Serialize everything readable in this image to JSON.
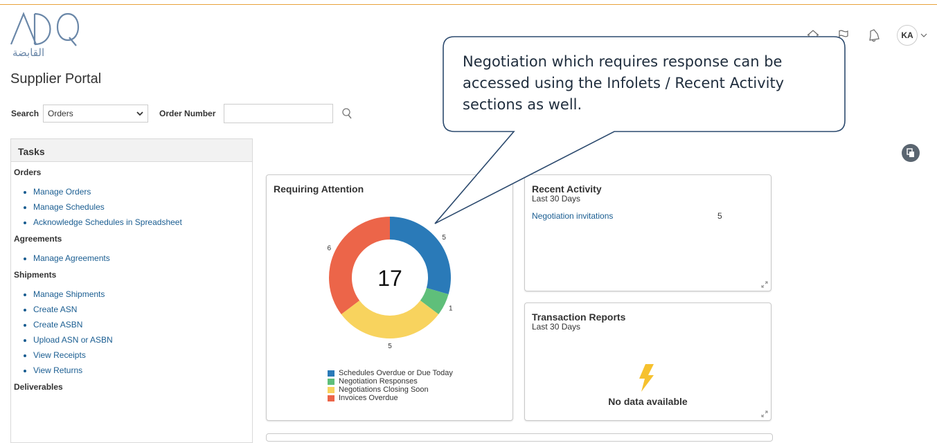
{
  "logo": {
    "latin": "ADQ",
    "arabic": "القابضة"
  },
  "portal_title": "Supplier Portal",
  "header": {
    "avatar_initials": "KA"
  },
  "search": {
    "label": "Search",
    "selected": "Orders",
    "order_number_label": "Order Number",
    "order_number_value": ""
  },
  "tasks": {
    "title": "Tasks",
    "sections": [
      {
        "title": "Orders",
        "items": [
          "Manage Orders",
          "Manage Schedules",
          "Acknowledge Schedules in Spreadsheet"
        ]
      },
      {
        "title": "Agreements",
        "items": [
          "Manage Agreements"
        ]
      },
      {
        "title": "Shipments",
        "items": [
          "Manage Shipments",
          "Create ASN",
          "Create ASBN",
          "Upload ASN or ASBN",
          "View Receipts",
          "View Returns"
        ]
      },
      {
        "title": "Deliverables",
        "items": []
      }
    ]
  },
  "requiring_attention": {
    "title": "Requiring Attention",
    "total": "17"
  },
  "chart_data": {
    "type": "pie",
    "donut": true,
    "title": "Requiring Attention",
    "center_label": "17",
    "categories": [
      "Schedules Overdue or Due Today",
      "Negotiation Responses",
      "Negotiations Closing Soon",
      "Invoices Overdue"
    ],
    "values": [
      5,
      1,
      5,
      6
    ],
    "colors": [
      "#2a7ab8",
      "#5fbf7a",
      "#f8d35e",
      "#ec6549"
    ],
    "legend_placement": "bottom"
  },
  "recent_activity": {
    "title": "Recent Activity",
    "subtitle": "Last 30 Days",
    "items": [
      {
        "label": "Negotiation invitations",
        "count": "5"
      }
    ]
  },
  "transaction_reports": {
    "title": "Transaction Reports",
    "subtitle": "Last 30 Days",
    "empty_text": "No data available"
  },
  "callout": {
    "line1": "Negotiation which requires response can be",
    "line2": "accessed using the Infolets / Recent Activity",
    "line3": "sections as well."
  },
  "colors": {
    "accent_line": "#e8a23a",
    "link": "#1a5d91",
    "lightning": "#f6c12e"
  },
  "icons": [
    "home-icon",
    "flag-icon",
    "bell-icon",
    "search-icon",
    "expand-icon",
    "lightning-icon",
    "chevron-down-icon"
  ]
}
